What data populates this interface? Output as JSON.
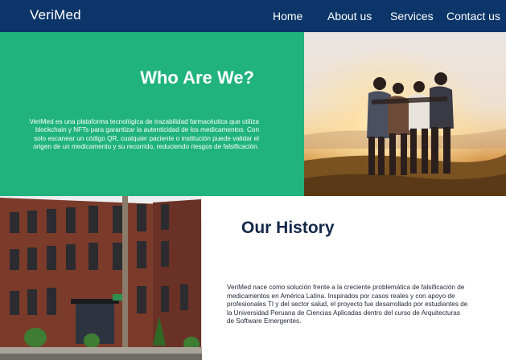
{
  "header": {
    "brand": "VeriMed",
    "nav": {
      "home": "Home",
      "about": "About us",
      "services": "Services",
      "contact": "Contact us"
    }
  },
  "about": {
    "title": "Who Are We?",
    "body": "VeriMed es una plataforma tecnológica de trazabilidad farmacéutica que utiliza blockchain y NFTs para garantizar la autenticidad de los medicamentos. Con solo escanear un código QR, cualquier paciente o institución puede validar el origen de un medicamento y su recorrido, reduciendo riesgos de falsificación."
  },
  "history": {
    "title": "Our History",
    "body": "VeriMed nace como solución frente a la creciente problemática de falsificación de medicamentos en América Latina. Inspirados por casos reales y con apoyo de profesionales TI y del sector salud, el proyecto fue desarrollado por estudiantes de la Universidad Peruana de Ciencias Aplicadas dentro del curso de Arquitecturas de Software Emergentes."
  },
  "colors": {
    "navbar": "#0c3669",
    "about_panel": "#20b37d",
    "history_title": "#13294a"
  }
}
